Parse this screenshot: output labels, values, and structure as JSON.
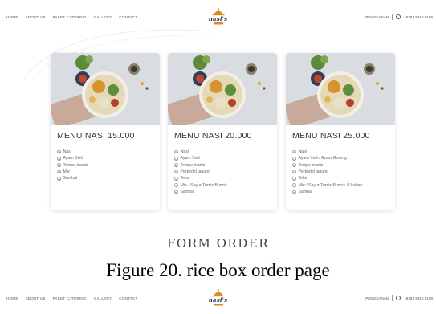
{
  "nav": {
    "menu": [
      "HOME",
      "ABOUT US",
      "PAKET CATERING",
      "GALLERY",
      "CONTACT"
    ],
    "logo": "nasi's",
    "order_link": "PEMESANAN",
    "phone": "+6281 9910 8109"
  },
  "cards": [
    {
      "title": "MENU NASI 15.000",
      "items": [
        "Nasi",
        "Ayam Sisit",
        "Tempe manis",
        "Mie",
        "Sambal"
      ]
    },
    {
      "title": "MENU NASI 20.000",
      "items": [
        "Nasi",
        "Ayam Sisit",
        "Tempe manis",
        "Perkedel jagung",
        "Telur",
        "Mie / Sayur Tumis Buncis",
        "Sambal"
      ]
    },
    {
      "title": "MENU NASI 25.000",
      "items": [
        "Nasi",
        "Ayam Sisit / Ayam Goreng",
        "Tempe manis",
        "Perkedel jagung",
        "Telur",
        "Mie / Sayur Tumis Buncis / Uraban",
        "Sambal"
      ]
    }
  ],
  "form_title": "FORM ORDER",
  "caption": "Figure 20. rice box order page",
  "colors": {
    "accent": "#e08a1e",
    "logo_text": "#2a2a4a"
  }
}
